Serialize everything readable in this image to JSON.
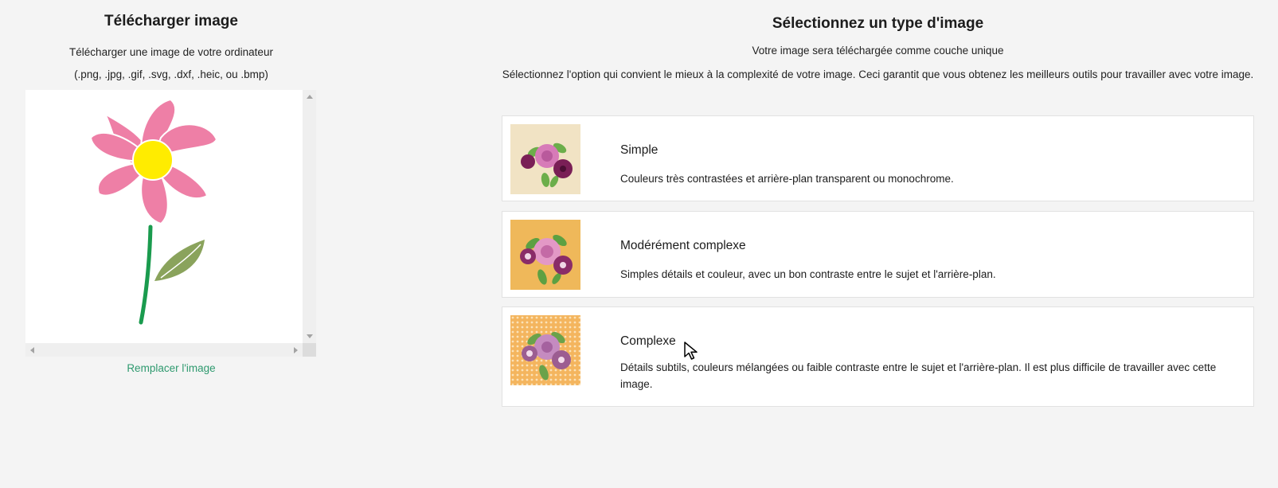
{
  "upload_panel": {
    "title": "Télécharger image",
    "subtitle": "Télécharger une image de votre ordinateur",
    "formats": "(.png, .jpg, .gif, .svg, .dxf, .heic, ou .bmp)",
    "replace_link": "Remplacer l'image",
    "preview_image": "flower-drawing"
  },
  "type_panel": {
    "title": "Sélectionnez un type d'image",
    "note": "Votre image sera téléchargée comme couche unique",
    "instruction": "Sélectionnez l'option qui convient le mieux à la complexité de votre image. Ceci garantit que vous obtenez les meilleurs outils pour travailler avec votre image.",
    "options": [
      {
        "title": "Simple",
        "description": "Couleurs très contrastées et arrière-plan transparent ou monochrome.",
        "thumb_bg": "#f1e3c4",
        "thumb_icon": "flower-bouquet-simple"
      },
      {
        "title": "Modérément complexe",
        "description": "Simples détails et couleur, avec un bon contraste entre le sujet et l'arrière-plan.",
        "thumb_bg": "#efb85a",
        "thumb_icon": "flower-bouquet-moderate"
      },
      {
        "title": "Complexe",
        "description": "Détails subtils, couleurs mélangées ou faible contraste entre le sujet et l'arrière-plan. Il est plus difficile de travailler avec cette image.",
        "thumb_bg": "#f4b55e",
        "thumb_icon": "flower-bouquet-complex"
      }
    ]
  },
  "colors": {
    "link": "#2f9a6f",
    "petal": "#ee7fa6",
    "center": "#ffec00",
    "stem": "#1a9b4e",
    "leaf": "#8aa35c"
  }
}
